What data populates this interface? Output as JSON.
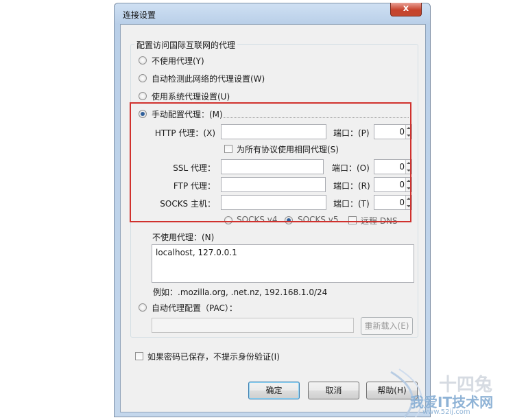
{
  "window": {
    "title": "连接设置",
    "close_glyph": "x"
  },
  "group": {
    "label": "配置访问国际互联网的代理"
  },
  "options": {
    "no_proxy": "不使用代理(Y)",
    "auto_detect": "自动检测此网络的代理设置(W)",
    "system": "使用系统代理设置(U)",
    "manual": "手动配置代理：(M)",
    "pac": "自动代理配置（PAC）："
  },
  "manual": {
    "http_label": "HTTP 代理：(X)",
    "http_value": "",
    "http_port_label": "端口：(P)",
    "http_port": "0",
    "same_proxy": "为所有协议使用相同代理(S)",
    "ssl_label": "SSL 代理：",
    "ssl_value": "",
    "ssl_port_label": "端口：(O)",
    "ssl_port": "0",
    "ftp_label": "FTP 代理：",
    "ftp_value": "",
    "ftp_port_label": "端口：(R)",
    "ftp_port": "0",
    "socks_label": "SOCKS 主机：",
    "socks_value": "",
    "socks_port_label": "端口：(T)",
    "socks_port": "0",
    "socks_v4": "SOCKS v4",
    "socks_v5": "SOCKS v5",
    "remote_dns": "远程 DNS"
  },
  "noproxy": {
    "label": "不使用代理：(N)",
    "value": "localhost, 127.0.0.1",
    "example": "例如：.mozilla.org, .net.nz, 192.168.1.0/24"
  },
  "pac": {
    "url": "",
    "reload": "重新载入(E)"
  },
  "auth": {
    "label": "如果密码已保存，不提示身份验证(I)"
  },
  "buttons": {
    "ok": "确定",
    "cancel": "取消",
    "help": "帮助(H)"
  },
  "watermark": {
    "line1": "十四兔",
    "line2": "我爱IT技术网",
    "line3": "www.52ij.com"
  },
  "colors": {
    "highlight": "#d0312d",
    "accent": "#2f5f9a"
  }
}
